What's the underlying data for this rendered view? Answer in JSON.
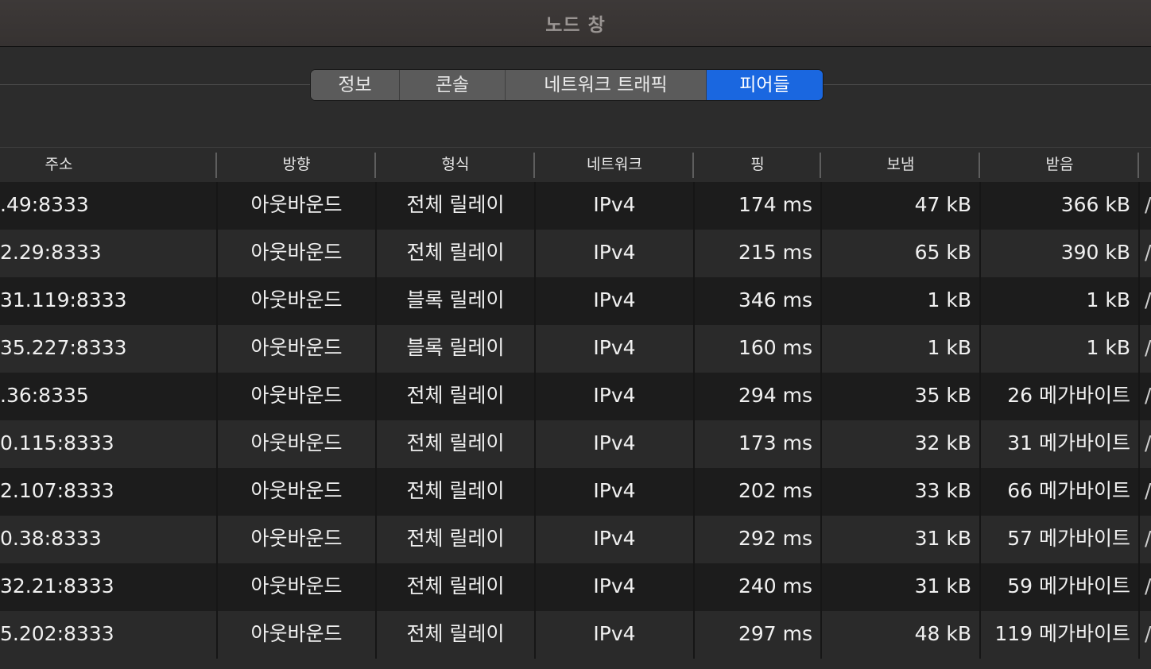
{
  "window": {
    "title": "노드 창"
  },
  "tabs": [
    {
      "label": "정보",
      "active": false
    },
    {
      "label": "콘솔",
      "active": false
    },
    {
      "label": "네트워크 트래픽",
      "active": false
    },
    {
      "label": "피어들",
      "active": true
    }
  ],
  "colors": {
    "active_tab": "#1a67e0",
    "row_dark": "#1c1c1c",
    "row_light": "#2a2a2a"
  },
  "table": {
    "headers": {
      "address": "주소",
      "direction": "방향",
      "type": "형식",
      "network": "네트워크",
      "ping": "핑",
      "sent": "보냄",
      "received": "받음"
    },
    "rows": [
      {
        "address": ".49:8333",
        "direction": "아웃바운드",
        "type": "전체 릴레이",
        "network": "IPv4",
        "ping": "174 ms",
        "sent": "47 kB",
        "received": "366 kB",
        "extra": "/"
      },
      {
        "address": "2.29:8333",
        "direction": "아웃바운드",
        "type": "전체 릴레이",
        "network": "IPv4",
        "ping": "215 ms",
        "sent": "65 kB",
        "received": "390 kB",
        "extra": "/"
      },
      {
        "address": "31.119:8333",
        "direction": "아웃바운드",
        "type": "블록 릴레이",
        "network": "IPv4",
        "ping": "346 ms",
        "sent": "1 kB",
        "received": "1 kB",
        "extra": "/"
      },
      {
        "address": "35.227:8333",
        "direction": "아웃바운드",
        "type": "블록 릴레이",
        "network": "IPv4",
        "ping": "160 ms",
        "sent": "1 kB",
        "received": "1 kB",
        "extra": "/"
      },
      {
        "address": ".36:8335",
        "direction": "아웃바운드",
        "type": "전체 릴레이",
        "network": "IPv4",
        "ping": "294 ms",
        "sent": "35 kB",
        "received": "26 메가바이트",
        "extra": "/"
      },
      {
        "address": "0.115:8333",
        "direction": "아웃바운드",
        "type": "전체 릴레이",
        "network": "IPv4",
        "ping": "173 ms",
        "sent": "32 kB",
        "received": "31 메가바이트",
        "extra": "/"
      },
      {
        "address": "2.107:8333",
        "direction": "아웃바운드",
        "type": "전체 릴레이",
        "network": "IPv4",
        "ping": "202 ms",
        "sent": "33 kB",
        "received": "66 메가바이트",
        "extra": "/"
      },
      {
        "address": "0.38:8333",
        "direction": "아웃바운드",
        "type": "전체 릴레이",
        "network": "IPv4",
        "ping": "292 ms",
        "sent": "31 kB",
        "received": "57 메가바이트",
        "extra": "/"
      },
      {
        "address": "32.21:8333",
        "direction": "아웃바운드",
        "type": "전체 릴레이",
        "network": "IPv4",
        "ping": "240 ms",
        "sent": "31 kB",
        "received": "59 메가바이트",
        "extra": "/"
      },
      {
        "address": "5.202:8333",
        "direction": "아웃바운드",
        "type": "전체 릴레이",
        "network": "IPv4",
        "ping": "297 ms",
        "sent": "48 kB",
        "received": "119 메가바이트",
        "extra": "/"
      }
    ]
  }
}
